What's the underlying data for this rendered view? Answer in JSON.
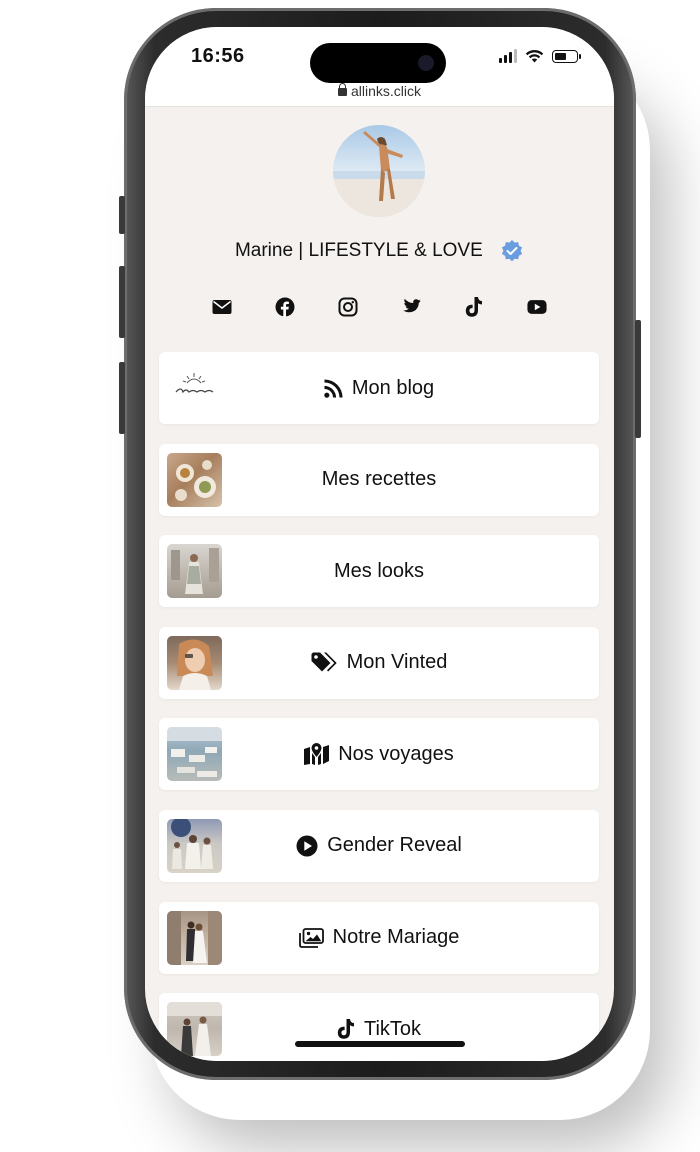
{
  "status_bar": {
    "time": "16:56",
    "battery_level_pct": 60
  },
  "browser": {
    "url": "allinks.click"
  },
  "profile": {
    "name": "Marine | LIFESTYLE & LOVE",
    "verified": true
  },
  "social_icons": [
    "mail-icon",
    "facebook-icon",
    "instagram-icon",
    "twitter-icon",
    "tiktok-icon",
    "youtube-icon"
  ],
  "links": [
    {
      "label": "Mon blog",
      "icon": "rss-icon",
      "thumb": "blog-logo"
    },
    {
      "label": "Mes recettes",
      "icon": "",
      "thumb": "recipes-photo"
    },
    {
      "label": "Mes looks",
      "icon": "",
      "thumb": "looks-photo"
    },
    {
      "label": "Mon Vinted",
      "icon": "tags-icon",
      "thumb": "vinted-photo"
    },
    {
      "label": "Nos voyages",
      "icon": "map-icon",
      "thumb": "travel-photo"
    },
    {
      "label": "Gender Reveal",
      "icon": "play-circle-icon",
      "thumb": "gender-reveal-photo"
    },
    {
      "label": "Notre Mariage",
      "icon": "images-icon",
      "thumb": "wedding-photo"
    },
    {
      "label": "TikTok",
      "icon": "tiktok-icon",
      "thumb": "tiktok-photo"
    }
  ],
  "colors": {
    "page_bg": "#f5f1ee",
    "button_bg": "#ffffff",
    "verified_badge": "#6a9de0",
    "text": "#111111"
  }
}
